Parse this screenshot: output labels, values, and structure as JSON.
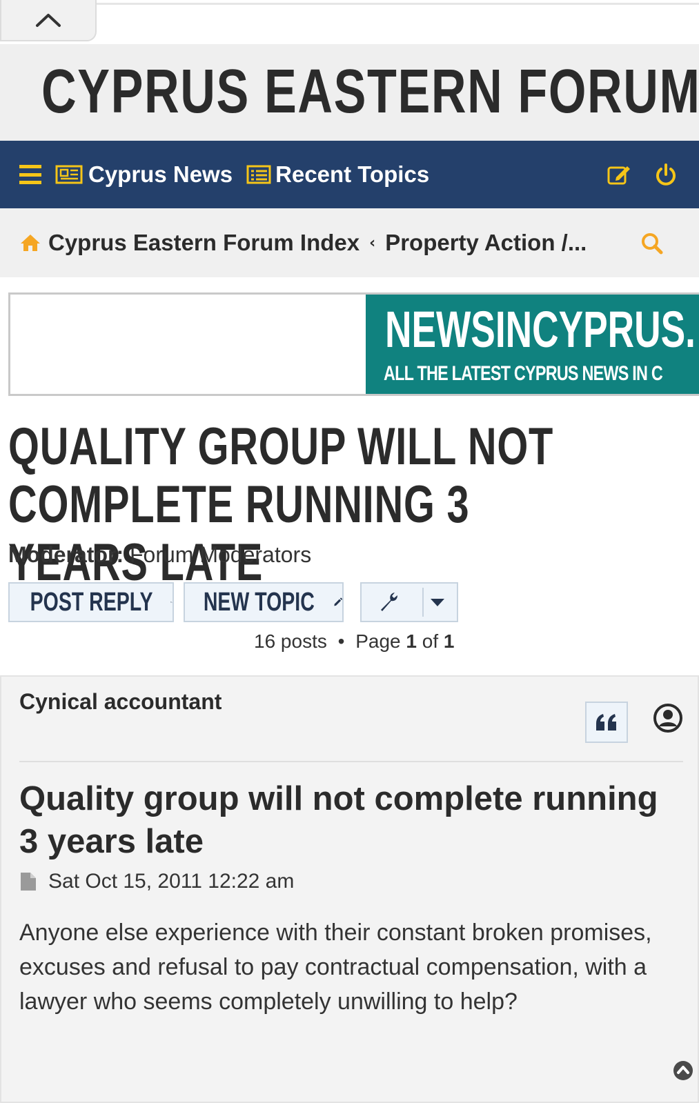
{
  "header": {
    "site_title": "CYPRUS EASTERN FORUM"
  },
  "nav": {
    "items": [
      {
        "label": "Cyprus News",
        "icon": "newspaper-icon"
      },
      {
        "label": "Recent Topics",
        "icon": "list-icon"
      }
    ],
    "menu_icon": "hamburger-icon",
    "right_icons": [
      "edit-icon",
      "power-icon"
    ],
    "color": "#24406b"
  },
  "breadcrumb": {
    "home_icon": "home-icon",
    "items": [
      "Cyprus Eastern Forum Index",
      "Property Action /..."
    ],
    "separator": "‹",
    "home_icon_color": "#f5a623"
  },
  "ad": {
    "title": "NEWSINCYPRUS.",
    "subtitle": "ALL THE LATEST CYPRUS NEWS IN C",
    "color": "#10827f"
  },
  "topic": {
    "title": "QUALITY GROUP WILL NOT COMPLETE RUNNING 3 YEARS LATE",
    "moderator_label": "Moderator:",
    "moderator_value": "Forum Moderators"
  },
  "actions": {
    "post_reply": "POST REPLY",
    "new_topic": "NEW TOPIC"
  },
  "pagination": {
    "posts": "16 posts",
    "separator": "•",
    "page_label": "Page",
    "page_current": "1",
    "of_label": "of",
    "page_total": "1"
  },
  "post": {
    "author": "Cynical accountant",
    "title": "Quality group will not complete running 3 years late",
    "date": "Sat Oct 15, 2011 12:22 am",
    "body": "Anyone else experience with their constant broken promises, excuses and refusal to pay contractual compensation, with a lawyer who seems completely unwilling to help?"
  }
}
